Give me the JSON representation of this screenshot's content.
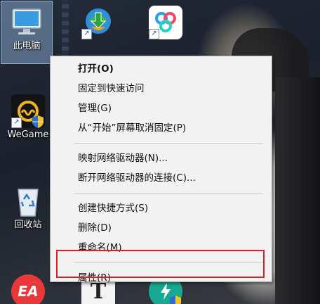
{
  "desktop": {
    "icons": [
      {
        "label": "此电脑"
      },
      {
        "label": ""
      },
      {
        "label": ""
      },
      {
        "label": "WeGame"
      },
      {
        "label": "回收站"
      }
    ],
    "bottom_icons": [
      {
        "label": "EA"
      },
      {
        "label": "T"
      }
    ]
  },
  "context_menu": {
    "groups": [
      [
        "打开(O)",
        "固定到快速访问",
        "管理(G)",
        "从“开始”屏幕取消固定(P)"
      ],
      [
        "映射网络驱动器(N)...",
        "断开网络驱动器的连接(C)..."
      ],
      [
        "创建快捷方式(S)",
        "删除(D)",
        "重命名(M)"
      ],
      [
        "属性(R)"
      ]
    ]
  },
  "colors": {
    "menu_bg": "#f2f2f2",
    "highlight": "#d8202a",
    "selection": "#96bee6"
  }
}
